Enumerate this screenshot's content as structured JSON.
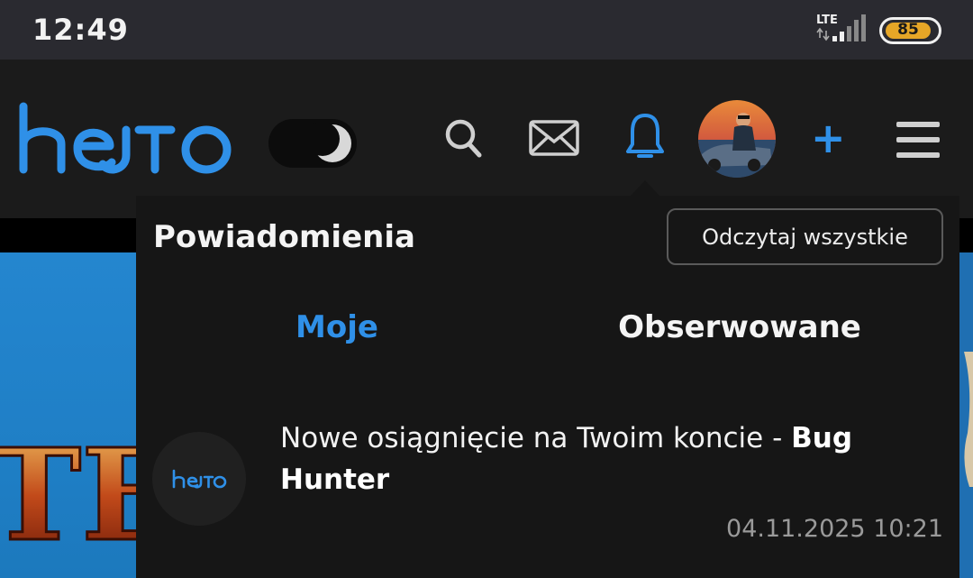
{
  "status_bar": {
    "time": "12:49",
    "network": "LTE",
    "battery": "85"
  },
  "header": {
    "logo": "hejto",
    "icons": [
      "search-icon",
      "mail-icon",
      "bell-icon",
      "user-avatar",
      "plus-icon",
      "menu-icon"
    ],
    "accent_color": "#2f90e8",
    "plus": "+"
  },
  "notifications": {
    "title": "Powiadomienia",
    "read_all_label": "Odczytaj wszystkie",
    "tabs": [
      {
        "label": "Moje",
        "active": true
      },
      {
        "label": "Obserwowane",
        "active": false
      }
    ],
    "items": [
      {
        "avatar_text": "hejto",
        "text": "Nowe osiągnięcie na Twoim koncie - ",
        "highlight": "Bug Hunter",
        "date": "04.11.2025 10:21"
      }
    ]
  },
  "background": {
    "banner_text": "TE"
  }
}
